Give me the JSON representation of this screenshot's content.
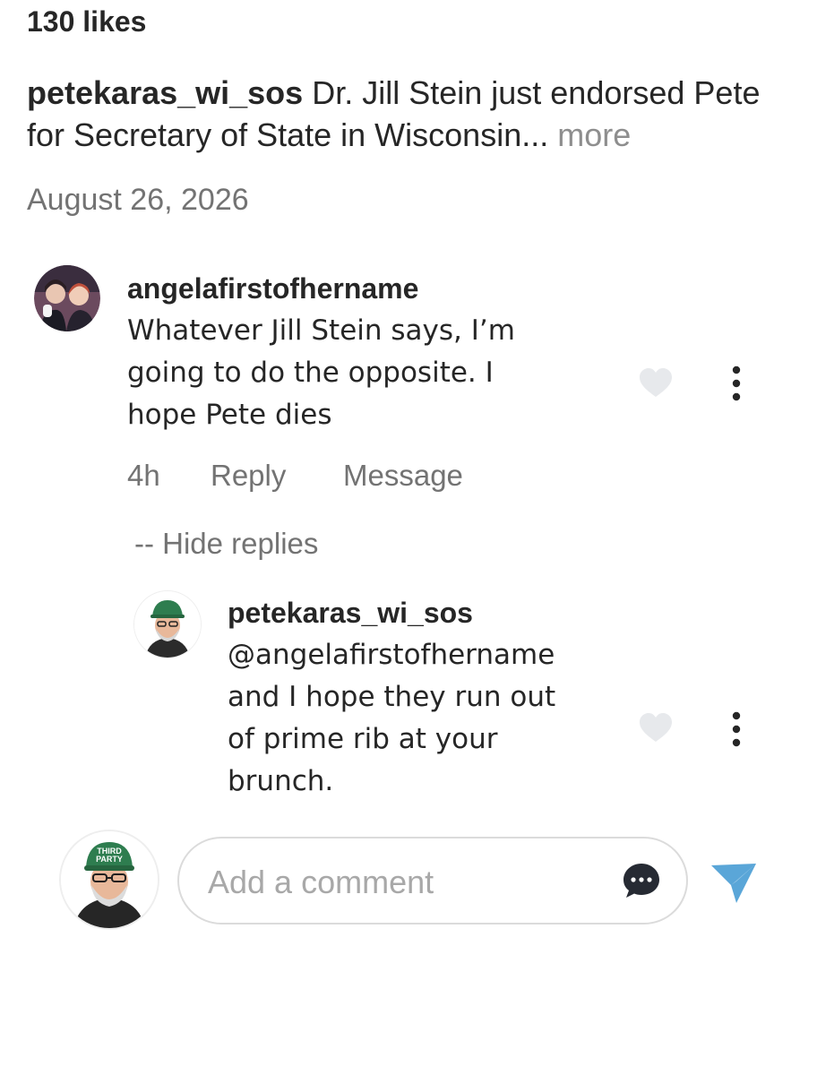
{
  "post": {
    "likes": "130 likes",
    "caption_user": "petekaras_wi_sos",
    "caption_text": " Dr. Jill Stein just endorsed Pete for Secretary of State in Wisconsin",
    "caption_ellipsis": "...",
    "caption_more": " more",
    "date": "August 26, 2026"
  },
  "comment": {
    "username": "angelafirstofhername",
    "lines": [
      "Whatever Jill Stein says, I’m",
      "going to do the opposite. I",
      "hope Pete dies"
    ],
    "time": "4h",
    "reply_label": "Reply",
    "message_label": "Message",
    "hide_replies_label": "-- Hide replies"
  },
  "reply": {
    "username": "petekaras_wi_sos",
    "lines": [
      "@angelafirstofhername",
      "and I hope they run out",
      "of prime rib at your",
      "brunch."
    ]
  },
  "composer": {
    "placeholder": "Add a comment",
    "hat_text_1": "THIRD",
    "hat_text_2": "PARTY"
  },
  "colors": {
    "hat_green": "#2e7d4f",
    "send_blue": "#5aa6d8",
    "heart_gray": "#e7e9ec",
    "muted_text": "#737373"
  },
  "icons": {
    "like": "heart-icon",
    "options": "more-vertical-icon",
    "emoji": "chat-bubble-icon",
    "send": "paper-plane-icon"
  }
}
